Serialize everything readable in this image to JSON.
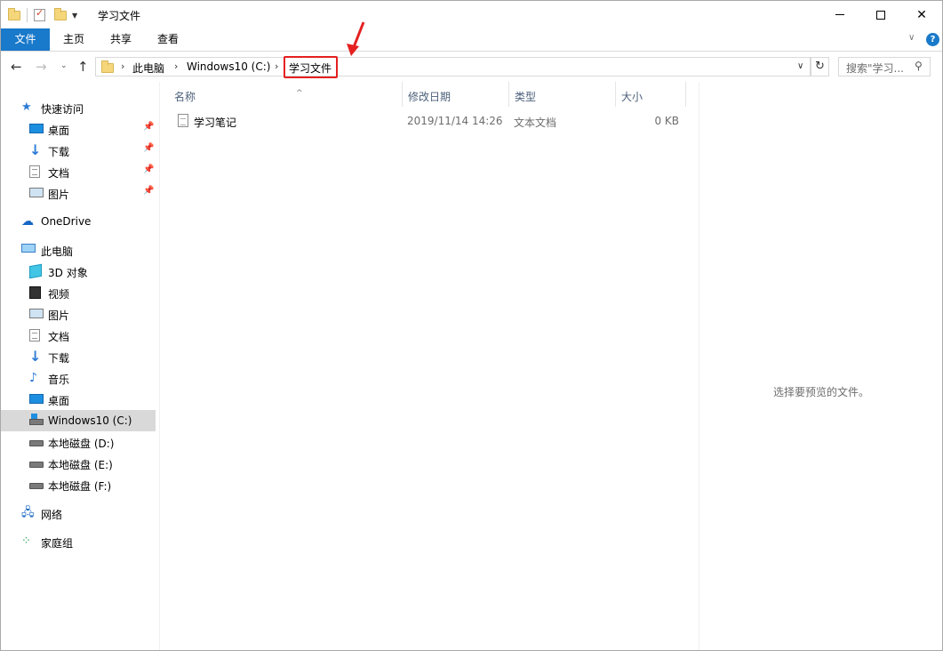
{
  "window": {
    "title": "学习文件"
  },
  "ribbon": {
    "tabs": [
      {
        "label": "文件"
      },
      {
        "label": "主页"
      },
      {
        "label": "共享"
      },
      {
        "label": "查看"
      }
    ]
  },
  "address": {
    "crumbs": [
      "此电脑",
      "Windows10 (C:)",
      "学习文件"
    ],
    "search_placeholder": "搜索\"学习..."
  },
  "sidebar": {
    "quick_access": {
      "label": "快速访问",
      "items": [
        {
          "label": "桌面",
          "icon": "desktop-icon",
          "pinned": true
        },
        {
          "label": "下载",
          "icon": "download-icon",
          "pinned": true
        },
        {
          "label": "文档",
          "icon": "document-icon",
          "pinned": true
        },
        {
          "label": "图片",
          "icon": "picture-icon",
          "pinned": true
        }
      ]
    },
    "onedrive": {
      "label": "OneDrive"
    },
    "this_pc": {
      "label": "此电脑",
      "items": [
        {
          "label": "3D 对象",
          "icon": "3d-objects-icon"
        },
        {
          "label": "视频",
          "icon": "video-icon"
        },
        {
          "label": "图片",
          "icon": "picture-icon"
        },
        {
          "label": "文档",
          "icon": "document-icon"
        },
        {
          "label": "下载",
          "icon": "download-icon"
        },
        {
          "label": "音乐",
          "icon": "music-icon"
        },
        {
          "label": "桌面",
          "icon": "desktop-icon"
        },
        {
          "label": "Windows10 (C:)",
          "icon": "system-drive-icon",
          "selected": true
        },
        {
          "label": "本地磁盘 (D:)",
          "icon": "drive-icon"
        },
        {
          "label": "本地磁盘 (E:)",
          "icon": "drive-icon"
        },
        {
          "label": "本地磁盘 (F:)",
          "icon": "drive-icon"
        }
      ]
    },
    "network": {
      "label": "网络"
    },
    "homegroup": {
      "label": "家庭组"
    }
  },
  "columns": {
    "name": "名称",
    "date": "修改日期",
    "type": "类型",
    "size": "大小"
  },
  "files": [
    {
      "name": "学习笔记",
      "date": "2019/11/14 14:26",
      "type": "文本文档",
      "size": "0 KB",
      "icon": "text-file-icon"
    }
  ],
  "preview": {
    "message": "选择要预览的文件。"
  },
  "colors": {
    "accent": "#1979ca",
    "highlight_annotation": "#e52020",
    "selected_row": "#d9d9d9"
  }
}
